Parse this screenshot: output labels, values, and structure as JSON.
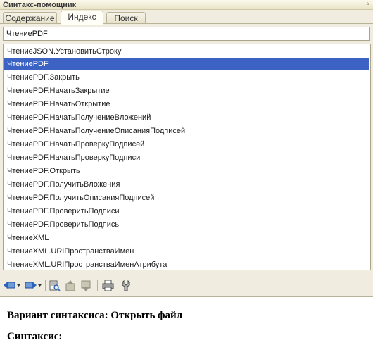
{
  "window": {
    "title": "Синтакс-помощник",
    "pin": "ª"
  },
  "tabs": [
    {
      "label": "Содержание",
      "active": false
    },
    {
      "label": "Индекс",
      "active": true
    },
    {
      "label": "Поиск",
      "active": false
    }
  ],
  "search": {
    "value": "ЧтениеPDF"
  },
  "list": {
    "selected_index": 1,
    "items": [
      "ЧтениеJSON.УстановитьСтроку",
      "ЧтениеPDF",
      "ЧтениеPDF.Закрыть",
      "ЧтениеPDF.НачатьЗакрытие",
      "ЧтениеPDF.НачатьОткрытие",
      "ЧтениеPDF.НачатьПолучениеВложений",
      "ЧтениеPDF.НачатьПолучениеОписанияПодписей",
      "ЧтениеPDF.НачатьПроверкуПодписей",
      "ЧтениеPDF.НачатьПроверкуПодписи",
      "ЧтениеPDF.Открыть",
      "ЧтениеPDF.ПолучитьВложения",
      "ЧтениеPDF.ПолучитьОписанияПодписей",
      "ЧтениеPDF.ПроверитьПодписи",
      "ЧтениеPDF.ПроверитьПодпись",
      "ЧтениеXML",
      "ЧтениеXML.URIПространстваИмен",
      "ЧтениеXML.URIПространстваИменАтрибута"
    ]
  },
  "toolbar": {
    "icons": [
      "back-arrow-icon",
      "forward-arrow-icon",
      "find-in-tree-icon",
      "go-up-icon",
      "go-down-icon",
      "print-icon",
      "settings-icon"
    ]
  },
  "content": {
    "heading": "Вариант синтаксиса: Открыть файл",
    "subheading": "Синтаксис:"
  },
  "colors": {
    "selection": "#3c63c4",
    "panel": "#f0ede0"
  }
}
